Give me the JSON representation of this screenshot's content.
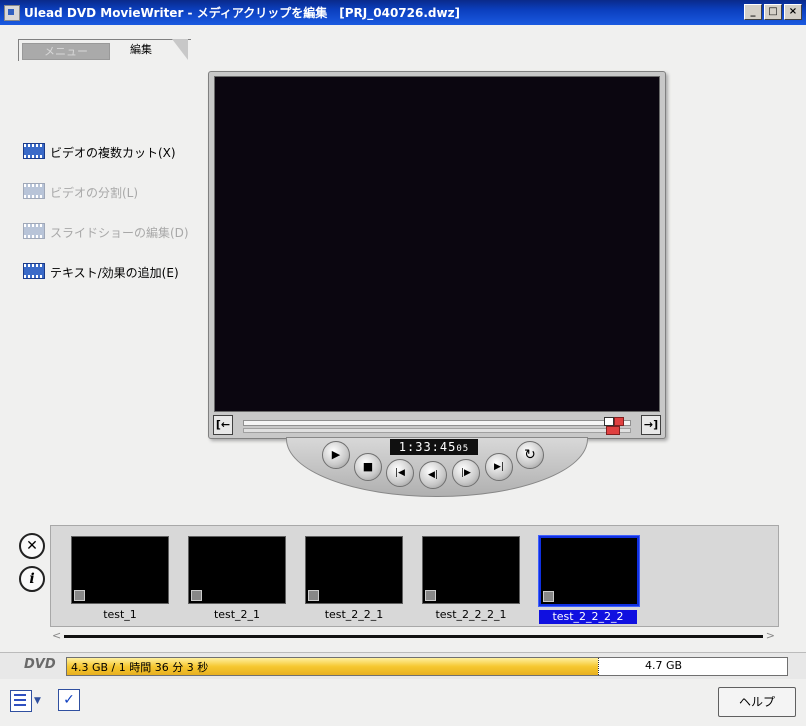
{
  "window": {
    "title": "Ulead DVD MovieWriter - メディアクリップを編集　[PRJ_040726.dwz]",
    "minimize": "_",
    "maximize": "□",
    "close": "×"
  },
  "tabs": {
    "menu": "メニュー",
    "edit": "編集"
  },
  "tasks": [
    {
      "label": "ビデオの複数カット(X)",
      "enabled": true
    },
    {
      "label": "ビデオの分割(L)",
      "enabled": false
    },
    {
      "label": "スライドショーの編集(D)",
      "enabled": false
    },
    {
      "label": "テキスト/効果の追加(E)",
      "enabled": true
    }
  ],
  "player": {
    "timecode": "1:33:45",
    "timecode_frames": "05",
    "timecode_spin": "▲▼",
    "mark_in": "[←",
    "mark_out": "→]",
    "buttons": {
      "play": "▶",
      "stop": "■",
      "first": "|◀",
      "prev_frame": "◀|",
      "next_frame": "|▶",
      "last": "▶|",
      "repeat": "↻"
    }
  },
  "clip_tray": {
    "delete_icon": "✕",
    "info_icon": "i",
    "clips": [
      {
        "label": "test_1",
        "selected": false
      },
      {
        "label": "test_2_1",
        "selected": false
      },
      {
        "label": "test_2_2_1",
        "selected": false
      },
      {
        "label": "test_2_2_2_1",
        "selected": false
      },
      {
        "label": "test_2_2_2_2",
        "selected": true
      }
    ],
    "scroll_left": "<",
    "scroll_right": ">"
  },
  "capacity": {
    "label": "DVD",
    "used_text": "4.3 GB / 1 時間 36 分 3 秒",
    "used_fraction": 0.737,
    "max_text": "4.7 GB",
    "mark_fraction": 0.803
  },
  "footer": {
    "help": "ヘルプ",
    "check": "✓"
  }
}
